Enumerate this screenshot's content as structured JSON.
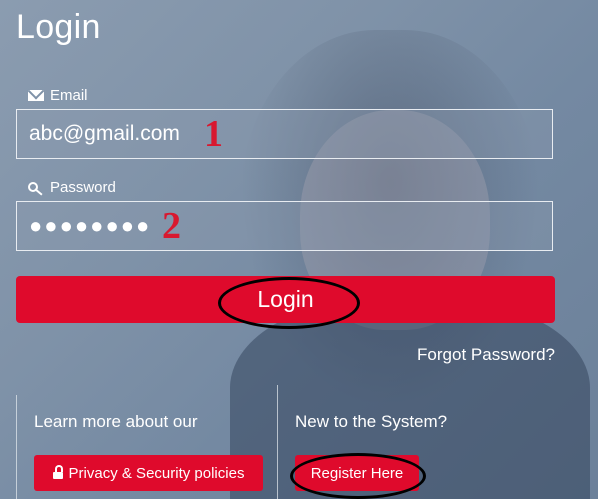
{
  "page": {
    "title": "Login"
  },
  "form": {
    "email": {
      "label": "Email",
      "icon": "envelope-icon",
      "value": "abc@gmail.com"
    },
    "password": {
      "label": "Password",
      "icon": "key-icon",
      "value": "●●●●●●●●"
    },
    "login_label": "Login",
    "forgot_label": "Forgot Password?"
  },
  "annotations": {
    "marker_1": "1",
    "marker_2": "2"
  },
  "panels": {
    "left": {
      "text": "Learn more about our",
      "button_label": "Privacy & Security policies",
      "button_icon": "lock-icon"
    },
    "right": {
      "text": "New to the System?",
      "button_label": "Register Here"
    }
  },
  "colors": {
    "accent": "#df0a2c",
    "annotation": "#d8182f",
    "background": "#7f92a8"
  }
}
